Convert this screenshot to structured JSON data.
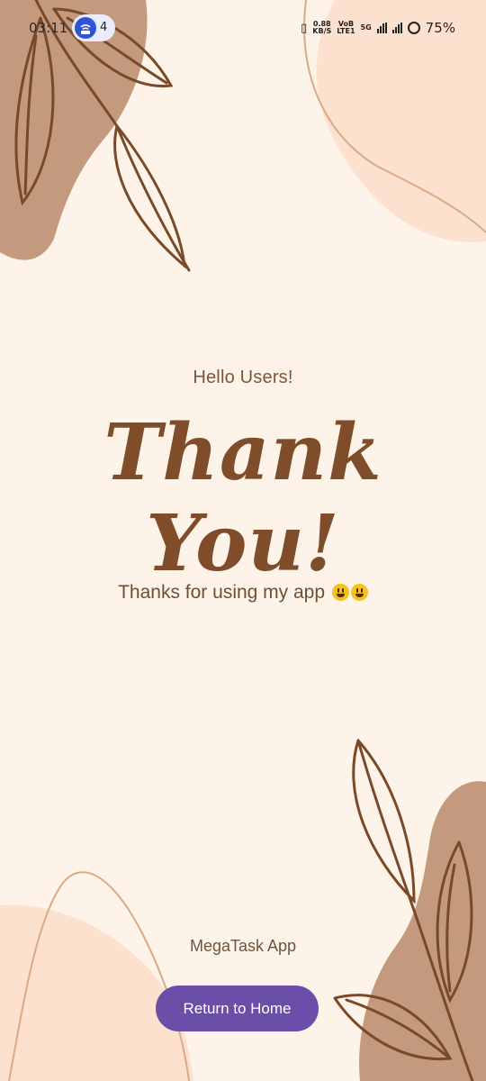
{
  "status_bar": {
    "time": "03:11",
    "notification_count": "4",
    "net_speed_value": "0.88",
    "net_speed_unit": "KB/S",
    "volte_top": "VoB",
    "volte_bottom": "LTE1",
    "network": "5G",
    "battery": "75%"
  },
  "content": {
    "greeting": "Hello Users!",
    "headline": "Thank You!",
    "subtitle": "Thanks for using my app",
    "app_name": "MegaTask App"
  },
  "actions": {
    "return_home_label": "Return to Home"
  },
  "colors": {
    "background": "#fdf3e8",
    "accent_button": "#6a4ea8",
    "headline": "#7f4d2a",
    "blob_dark": "#c39a7d",
    "blob_light": "#fde1cf"
  }
}
